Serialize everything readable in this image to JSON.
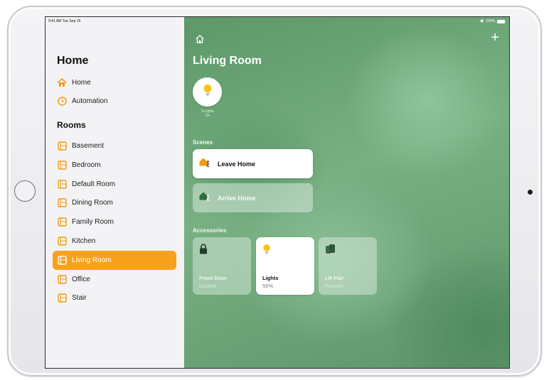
{
  "status_bar": {
    "time_date": "9:41 AM  Tue Sep 15",
    "battery": "100%"
  },
  "sidebar": {
    "title": "Home",
    "nav": [
      {
        "label": "Home",
        "icon": "home-icon"
      },
      {
        "label": "Automation",
        "icon": "clock-icon"
      }
    ],
    "rooms_title": "Rooms",
    "rooms": [
      {
        "label": "Basement",
        "icon": "room-icon",
        "selected": false
      },
      {
        "label": "Bedroom",
        "icon": "room-icon",
        "selected": false
      },
      {
        "label": "Default Room",
        "icon": "room-icon",
        "selected": false
      },
      {
        "label": "Dining Room",
        "icon": "room-icon",
        "selected": false
      },
      {
        "label": "Family Room",
        "icon": "room-icon",
        "selected": false
      },
      {
        "label": "Kitchen",
        "icon": "room-icon",
        "selected": false
      },
      {
        "label": "Living Room",
        "icon": "room-icon",
        "selected": true
      },
      {
        "label": "Office",
        "icon": "room-icon",
        "selected": false
      },
      {
        "label": "Stair",
        "icon": "room-icon",
        "selected": false
      }
    ]
  },
  "main": {
    "add_label": "+",
    "room_title": "Living Room",
    "lights_status": {
      "line1": "3 Lights",
      "line2": "On"
    },
    "scenes_title": "Scenes",
    "scenes": [
      {
        "label": "Leave Home",
        "icon": "leave-home-icon",
        "active": true
      },
      {
        "label": "Arrive Home",
        "icon": "arrive-home-icon",
        "active": false
      }
    ],
    "accessories_title": "Accessories",
    "accessories": [
      {
        "name": "Front Door",
        "status": "Locked",
        "icon": "lock-icon",
        "on": false
      },
      {
        "name": "Lights",
        "status": "55%",
        "icon": "lightbulb-icon",
        "on": true
      },
      {
        "name": "LR Pair",
        "status": "Paused",
        "icon": "speaker-icon",
        "on": false
      }
    ]
  },
  "colors": {
    "accent_orange": "#f7a21b",
    "bulb_yellow": "#f9c418",
    "main_green": "#6fa97b",
    "sidebar_bg": "#f3f3f5"
  }
}
